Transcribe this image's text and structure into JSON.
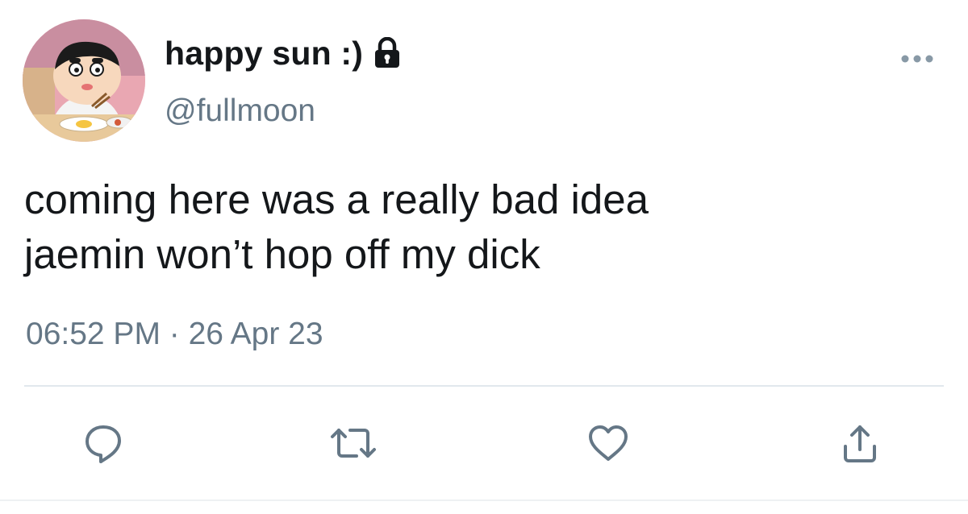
{
  "user": {
    "display_name": "happy sun :)",
    "handle": "@fullmoon",
    "avatar_icon": "cartoon-boy-avatar",
    "protected": true
  },
  "tweet": {
    "lines": [
      "coming here was a really bad idea",
      "jaemin won’t hop off my dick"
    ],
    "timestamp": "06:52 PM · 26 Apr 23"
  },
  "actions": [
    {
      "name": "reply",
      "icon": "reply-icon"
    },
    {
      "name": "retweet",
      "icon": "retweet-icon"
    },
    {
      "name": "like",
      "icon": "heart-icon"
    },
    {
      "name": "share",
      "icon": "share-icon"
    }
  ],
  "colors": {
    "text": "#14171a",
    "secondary": "#657786",
    "icon": "#657786",
    "divider": "#e1e8ed"
  }
}
